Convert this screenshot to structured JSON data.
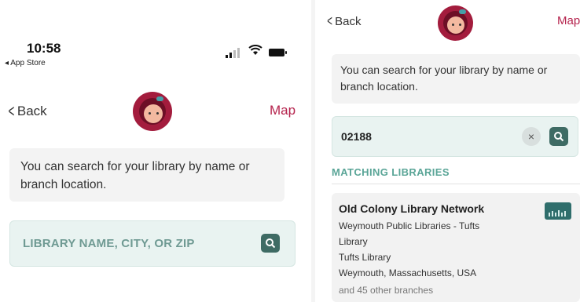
{
  "left": {
    "status_bar": {
      "time": "10:58",
      "back_to_app": "◂ App Store"
    },
    "nav": {
      "back_label": "Back",
      "map_label": "Map"
    },
    "info_text": "You can search for your library by name or branch location.",
    "search": {
      "placeholder": "LIBRARY NAME, CITY, OR ZIP"
    }
  },
  "right": {
    "nav": {
      "back_label": "Back",
      "map_label": "Map"
    },
    "info_text": "You can search for your library by name or branch location.",
    "search": {
      "query": "02188",
      "clear_symbol": "×"
    },
    "section_heading": "MATCHING LIBRARIES",
    "results": [
      {
        "name": "Old Colony Library Network",
        "line1": "Weymouth Public Libraries - Tufts",
        "line2": "Library",
        "line3": "Tufts Library",
        "line4": "Weymouth, Massachusetts, USA",
        "more": "and 45 other branches"
      }
    ]
  },
  "icons": [
    "chevron-left-icon",
    "search-icon",
    "clear-icon",
    "wifi-icon",
    "battery-icon",
    "signal-icon"
  ],
  "colors": {
    "brand": "#b5234d",
    "teal": "#3e6b64",
    "accent_green": "#5aa597"
  }
}
